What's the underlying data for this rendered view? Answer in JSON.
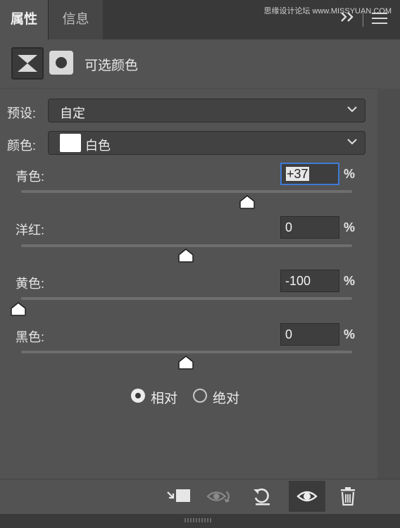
{
  "tabs": [
    {
      "label": "属性",
      "active": true
    },
    {
      "label": "信息",
      "active": false
    }
  ],
  "watermark": "思缘设计论坛 www.MISSYUAN.COM",
  "header": {
    "collapse_icon": "double-chevron-right-icon",
    "menu_icon": "menu-icon"
  },
  "panel": {
    "title": "可选颜色",
    "icons": [
      "adjustment-layer-icon",
      "mask-icon"
    ]
  },
  "preset": {
    "label": "预设:",
    "value": "自定"
  },
  "color": {
    "label": "颜色:",
    "value": "白色",
    "swatch": "#ffffff"
  },
  "sliders": [
    {
      "label": "青色:",
      "value": "+37",
      "number": 37,
      "focused": true,
      "unit": "%"
    },
    {
      "label": "洋红:",
      "value": "0",
      "number": 0,
      "focused": false,
      "unit": "%"
    },
    {
      "label": "黄色:",
      "value": "-100",
      "number": -100,
      "focused": false,
      "unit": "%"
    },
    {
      "label": "黑色:",
      "value": "0",
      "number": 0,
      "focused": false,
      "unit": "%"
    }
  ],
  "method": {
    "options": [
      {
        "label": "相对",
        "selected": true
      },
      {
        "label": "绝对",
        "selected": false
      }
    ]
  },
  "toolbar": {
    "buttons": [
      "clip-to-layer-icon",
      "view-previous-state-icon",
      "reset-icon",
      "visibility-eye-icon",
      "trash-icon"
    ]
  },
  "colors": {
    "panel_bg": "#535353",
    "tab_bg": "#393939",
    "focus": "#3e7bd6"
  }
}
